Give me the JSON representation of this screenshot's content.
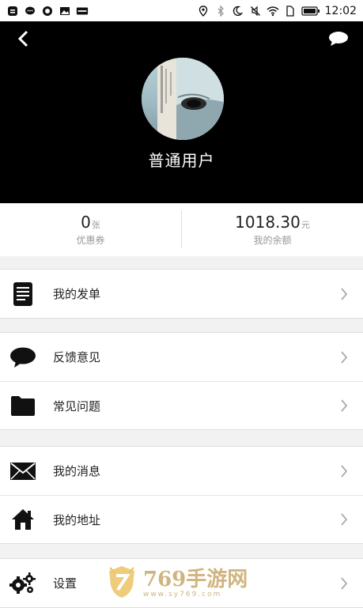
{
  "status_bar": {
    "time": "12:02",
    "left_icons": [
      "message-icon",
      "chat-bubble-icon",
      "message-bubble-icon",
      "image-icon",
      "app-badge-icon"
    ],
    "right_icons": [
      "location-icon",
      "bluetooth-icon",
      "moon-icon",
      "mute-icon",
      "wifi-icon",
      "sim-icon",
      "battery-icon"
    ]
  },
  "header": {
    "back_icon": "back-chevron-icon",
    "chat_icon": "chat-bubble-icon",
    "username": "普通用户"
  },
  "stats": {
    "coupons": {
      "value": "0",
      "unit": "张",
      "label": "优惠券"
    },
    "balance": {
      "value": "1018.30",
      "unit": "元",
      "label": "我的余额"
    }
  },
  "menu": {
    "orders": "我的发单",
    "feedback": "反馈意见",
    "faq": "常见问题",
    "messages": "我的消息",
    "address": "我的地址",
    "settings": "设置"
  },
  "watermark": {
    "main": "769手游网",
    "sub": "www.sy769.com"
  }
}
